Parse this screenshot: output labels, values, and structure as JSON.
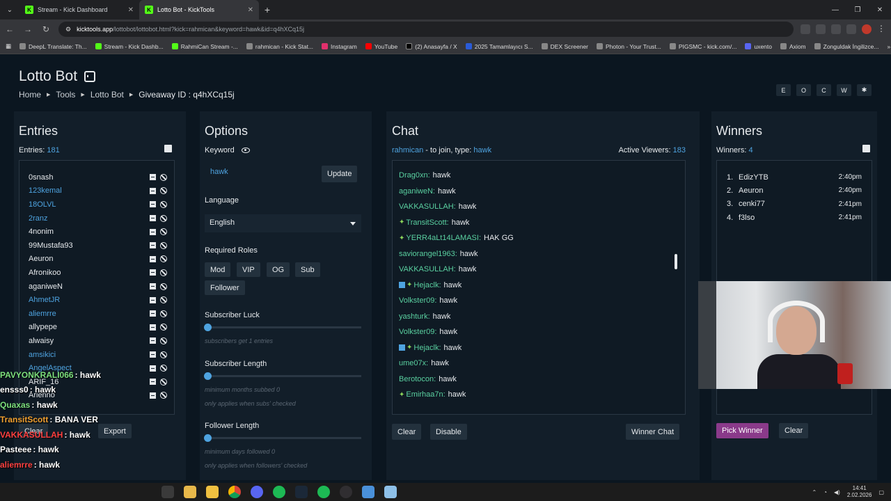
{
  "browser": {
    "tabs": [
      {
        "label": "Stream - Kick Dashboard",
        "active": false
      },
      {
        "label": "Lotto Bot - KickTools",
        "active": true
      }
    ],
    "url_host": "kicktools.app",
    "url_path": "/lottobot/lottobot.html?kick=rahmican&keyword=hawk&id=q4hXCq15j",
    "bookmarks": [
      "DeepL Translate: Th...",
      "Stream - Kick Dashb...",
      "RahmiCan Stream -...",
      "rahmican - Kick Stat...",
      "Instagram",
      "YouTube",
      "(2) Anasayfa / X",
      "2025 Tamamlayıcı S...",
      "DEX Screener",
      "Photon - Your Trust...",
      "PIGSMC - kick.com/...",
      "uxento",
      "Axiom",
      "Zonguldak İngilizce..."
    ]
  },
  "header": {
    "title": "Lotto Bot",
    "crumbs": [
      "Home",
      "Tools",
      "Lotto Bot"
    ],
    "giveaway_label": "Giveaway ID :",
    "giveaway_id": "q4hXCq15j",
    "theme_buttons": [
      "E",
      "O",
      "C",
      "W",
      "✱"
    ]
  },
  "entries": {
    "title": "Entries",
    "count_label": "Entries:",
    "count": "181",
    "items": [
      {
        "name": "0snash",
        "sub": false
      },
      {
        "name": "123kemal",
        "sub": true
      },
      {
        "name": "18OLVL",
        "sub": true
      },
      {
        "name": "2ranz",
        "sub": true
      },
      {
        "name": "4nonim",
        "sub": false
      },
      {
        "name": "99Mustafa93",
        "sub": false
      },
      {
        "name": "Aeuron",
        "sub": false
      },
      {
        "name": "Afronikoo",
        "sub": false
      },
      {
        "name": "aganiweN",
        "sub": false
      },
      {
        "name": "AhmetJR",
        "sub": true
      },
      {
        "name": "aliemrre",
        "sub": true
      },
      {
        "name": "allypepe",
        "sub": false
      },
      {
        "name": "alwaisy",
        "sub": false
      },
      {
        "name": "amsikici",
        "sub": true
      },
      {
        "name": "AngelAspect",
        "sub": true
      },
      {
        "name": "ARIF_16",
        "sub": false
      },
      {
        "name": "Arienno",
        "sub": false
      }
    ],
    "clear_label": "Clear",
    "export_label": "Export"
  },
  "options": {
    "title": "Options",
    "keyword_label": "Keyword",
    "keyword_value": "hawk",
    "update_label": "Update",
    "language_label": "Language",
    "language_value": "English",
    "roles_label": "Required Roles",
    "roles": [
      "Mod",
      "VIP",
      "OG",
      "Sub",
      "Follower"
    ],
    "sub_luck_label": "Subscriber Luck",
    "sub_luck_hint": "subscribers get 1 entries",
    "sub_length_label": "Subscriber Length",
    "sub_length_hint": "minimum months subbed 0",
    "sub_length_hint2": "only applies when subs' checked",
    "follow_length_label": "Follower Length",
    "follow_length_hint": "minimum days followed 0",
    "follow_length_hint2": "only applies when followers' checked"
  },
  "chat": {
    "title": "Chat",
    "channel": "rahmican",
    "join_text": " - to join, type: ",
    "keyword": "hawk",
    "viewers_label": "Active Viewers:",
    "viewers": "183",
    "messages": [
      {
        "user": "Drag0xn:",
        "text": "hawk",
        "badge": ""
      },
      {
        "user": "aganiweN:",
        "text": "hawk",
        "badge": ""
      },
      {
        "user": "VAKKASULLAH:",
        "text": "hawk",
        "badge": ""
      },
      {
        "user": "TransitScott:",
        "text": "hawk",
        "badge": "star"
      },
      {
        "user": "YERR4aLt14LAMASI:",
        "text": "HAK GG",
        "badge": "star"
      },
      {
        "user": "saviorangel1963:",
        "text": "hawk",
        "badge": ""
      },
      {
        "user": "VAKKASULLAH:",
        "text": "hawk",
        "badge": ""
      },
      {
        "user": "Hejaclk:",
        "text": "hawk",
        "badge": "both"
      },
      {
        "user": "Volkster09:",
        "text": "hawk",
        "badge": ""
      },
      {
        "user": "yashturk:",
        "text": "hawk",
        "badge": ""
      },
      {
        "user": "Volkster09:",
        "text": "hawk",
        "badge": ""
      },
      {
        "user": "Hejaclk:",
        "text": "hawk",
        "badge": "both"
      },
      {
        "user": "ume07x:",
        "text": "hawk",
        "badge": ""
      },
      {
        "user": "Berotocon:",
        "text": "hawk",
        "badge": ""
      },
      {
        "user": "Emirhaa7n:",
        "text": "hawk",
        "badge": "star"
      }
    ],
    "clear_label": "Clear",
    "disable_label": "Disable",
    "winner_chat_label": "Winner Chat"
  },
  "winners": {
    "title": "Winners",
    "count_label": "Winners:",
    "count": "4",
    "items": [
      {
        "n": "1.",
        "name": "EdizYTB",
        "time": "2:40pm"
      },
      {
        "n": "2.",
        "name": "Aeuron",
        "time": "2:40pm"
      },
      {
        "n": "3.",
        "name": "cenki77",
        "time": "2:41pm"
      },
      {
        "n": "4.",
        "name": "f3lso",
        "time": "2:41pm"
      }
    ],
    "pick_label": "Pick Winner",
    "clear_label": "Clear"
  },
  "overlay_chat": [
    {
      "user": "PAVYONKRALI066",
      "text": " : hawk",
      "color": "#7de07d"
    },
    {
      "user": "ensss0",
      "text": " : hawk",
      "color": "#ffffff"
    },
    {
      "user": "Quaxas",
      "text": " : hawk",
      "color": "#7de07d"
    },
    {
      "user": "TransitScott",
      "text": " : BANA VER",
      "color": "#f0a030"
    },
    {
      "user": "VAKKASULLAH",
      "text": " : hawk",
      "color": "#ff4040"
    },
    {
      "user": "Pasteee",
      "text": " : hawk",
      "color": "#ffffff"
    },
    {
      "user": "aliemrre",
      "text": " : hawk",
      "color": "#ff4040"
    }
  ],
  "taskbar": {
    "time": "14:41",
    "date": "2.02.2026"
  }
}
